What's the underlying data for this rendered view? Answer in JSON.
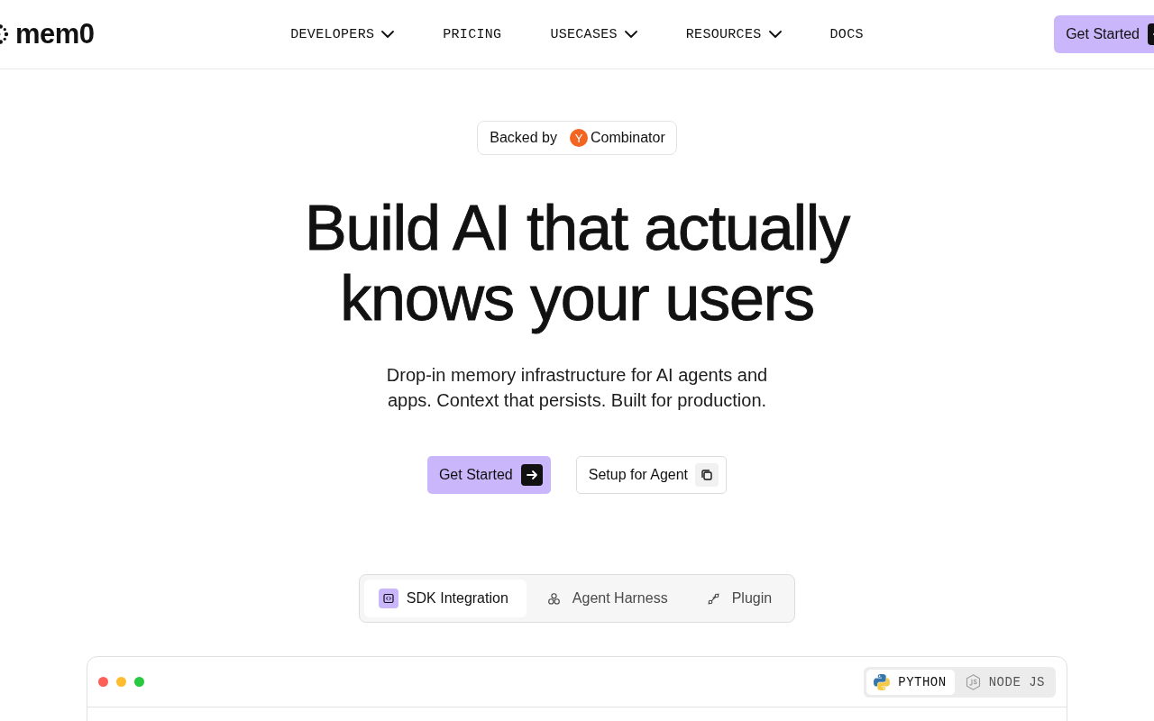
{
  "header": {
    "logo": {
      "text": "mem0"
    },
    "nav": [
      {
        "label": "DEVELOPERS",
        "dropdown": true
      },
      {
        "label": "PRICING",
        "dropdown": false
      },
      {
        "label": "USECASES",
        "dropdown": true
      },
      {
        "label": "RESOURCES",
        "dropdown": true
      },
      {
        "label": "DOCS",
        "dropdown": false
      }
    ],
    "cta": {
      "label": "Get Started"
    }
  },
  "badge": {
    "prefix": "Backed by",
    "mark": "Y",
    "name": "Combinator"
  },
  "hero": {
    "title": "Build AI that actually knows your users",
    "subtitle": "Drop-in memory infrastructure for AI agents and apps. Context that persists. Built for production.",
    "buttons": [
      {
        "label": "Get Started",
        "kind": "primary"
      },
      {
        "label": "Setup for Agent",
        "kind": "copy"
      }
    ]
  },
  "tabs": [
    {
      "label": "SDK Integration",
      "kind": "sdk",
      "selected": true
    },
    {
      "label": "Agent Harness",
      "kind": "harness",
      "selected": false
    },
    {
      "label": "Plugin",
      "kind": "plugin",
      "selected": false
    }
  ],
  "code_window": {
    "languages": [
      {
        "label": "PYTHON",
        "kind": "python",
        "selected": true
      },
      {
        "label": "NODE JS",
        "kind": "node",
        "selected": false
      }
    ]
  }
}
